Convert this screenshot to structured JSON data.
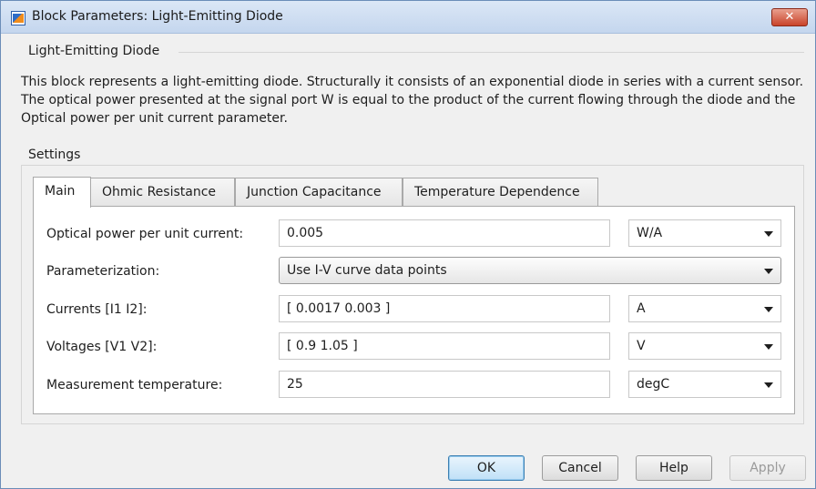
{
  "window": {
    "title": "Block Parameters: Light-Emitting Diode",
    "close_label": "✕"
  },
  "description_group": {
    "title": "Light-Emitting Diode",
    "text": "This block represents a light-emitting diode. Structurally it consists of an exponential diode in series with a current sensor. The optical power presented at the signal port W is equal to the product of the current flowing through the diode and the Optical power per unit current parameter."
  },
  "settings": {
    "title": "Settings",
    "tabs": [
      {
        "label": "Main",
        "active": true
      },
      {
        "label": "Ohmic Resistance",
        "active": false
      },
      {
        "label": "Junction Capacitance",
        "active": false
      },
      {
        "label": "Temperature Dependence",
        "active": false
      }
    ],
    "rows": [
      {
        "label": "Optical power per unit current:",
        "value": "0.005",
        "unit": "W/A"
      },
      {
        "label": "Parameterization:",
        "value": "Use I-V curve data points"
      },
      {
        "label": "Currents [I1 I2]:",
        "value": "[ 0.0017 0.003 ]",
        "unit": "A"
      },
      {
        "label": "Voltages [V1 V2]:",
        "value": "[ 0.9 1.05 ]",
        "unit": "V"
      },
      {
        "label": "Measurement temperature:",
        "value": "25",
        "unit": "degC"
      }
    ]
  },
  "buttons": {
    "ok": "OK",
    "cancel": "Cancel",
    "help": "Help",
    "apply": "Apply"
  }
}
